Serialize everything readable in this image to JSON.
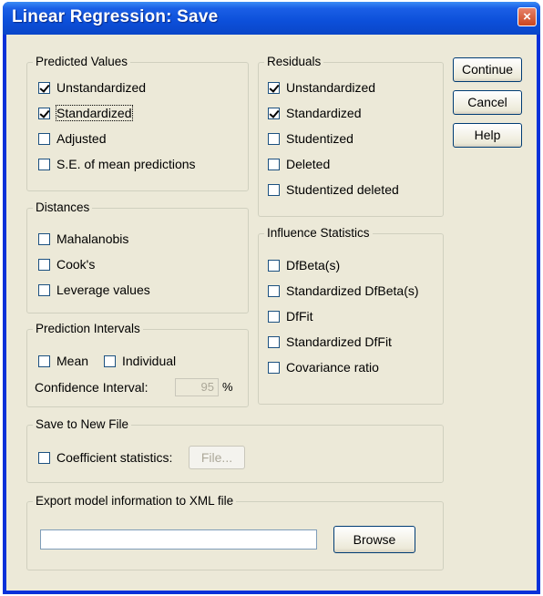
{
  "window": {
    "title": "Linear Regression: Save",
    "close_glyph": "×"
  },
  "buttons": {
    "continue": "Continue",
    "cancel": "Cancel",
    "help": "Help",
    "file": "File...",
    "browse": "Browse"
  },
  "predicted_values": {
    "legend": "Predicted Values",
    "items": [
      {
        "label": "Unstandardized",
        "checked": true
      },
      {
        "label": "Standardized",
        "checked": true
      },
      {
        "label": "Adjusted",
        "checked": false
      },
      {
        "label": "S.E. of mean predictions",
        "checked": false
      }
    ]
  },
  "residuals": {
    "legend": "Residuals",
    "items": [
      {
        "label": "Unstandardized",
        "checked": true
      },
      {
        "label": "Standardized",
        "checked": true
      },
      {
        "label": "Studentized",
        "checked": false
      },
      {
        "label": "Deleted",
        "checked": false
      },
      {
        "label": "Studentized deleted",
        "checked": false
      }
    ]
  },
  "distances": {
    "legend": "Distances",
    "items": [
      {
        "label": "Mahalanobis",
        "checked": false
      },
      {
        "label": "Cook's",
        "checked": false
      },
      {
        "label": "Leverage values",
        "checked": false
      }
    ]
  },
  "influence": {
    "legend": "Influence Statistics",
    "items": [
      {
        "label": "DfBeta(s)",
        "checked": false
      },
      {
        "label": "Standardized DfBeta(s)",
        "checked": false
      },
      {
        "label": "DfFit",
        "checked": false
      },
      {
        "label": "Standardized DfFit",
        "checked": false
      },
      {
        "label": "Covariance ratio",
        "checked": false
      }
    ]
  },
  "prediction_intervals": {
    "legend": "Prediction Intervals",
    "mean": {
      "label": "Mean",
      "checked": false
    },
    "individual": {
      "label": "Individual",
      "checked": false
    },
    "ci_label": "Confidence Interval:",
    "ci_value": "95",
    "ci_unit": "%"
  },
  "save_new_file": {
    "legend": "Save to New File",
    "coef": {
      "label": "Coefficient statistics:",
      "checked": false
    }
  },
  "export_xml": {
    "legend": "Export model information to XML file",
    "path_value": ""
  }
}
